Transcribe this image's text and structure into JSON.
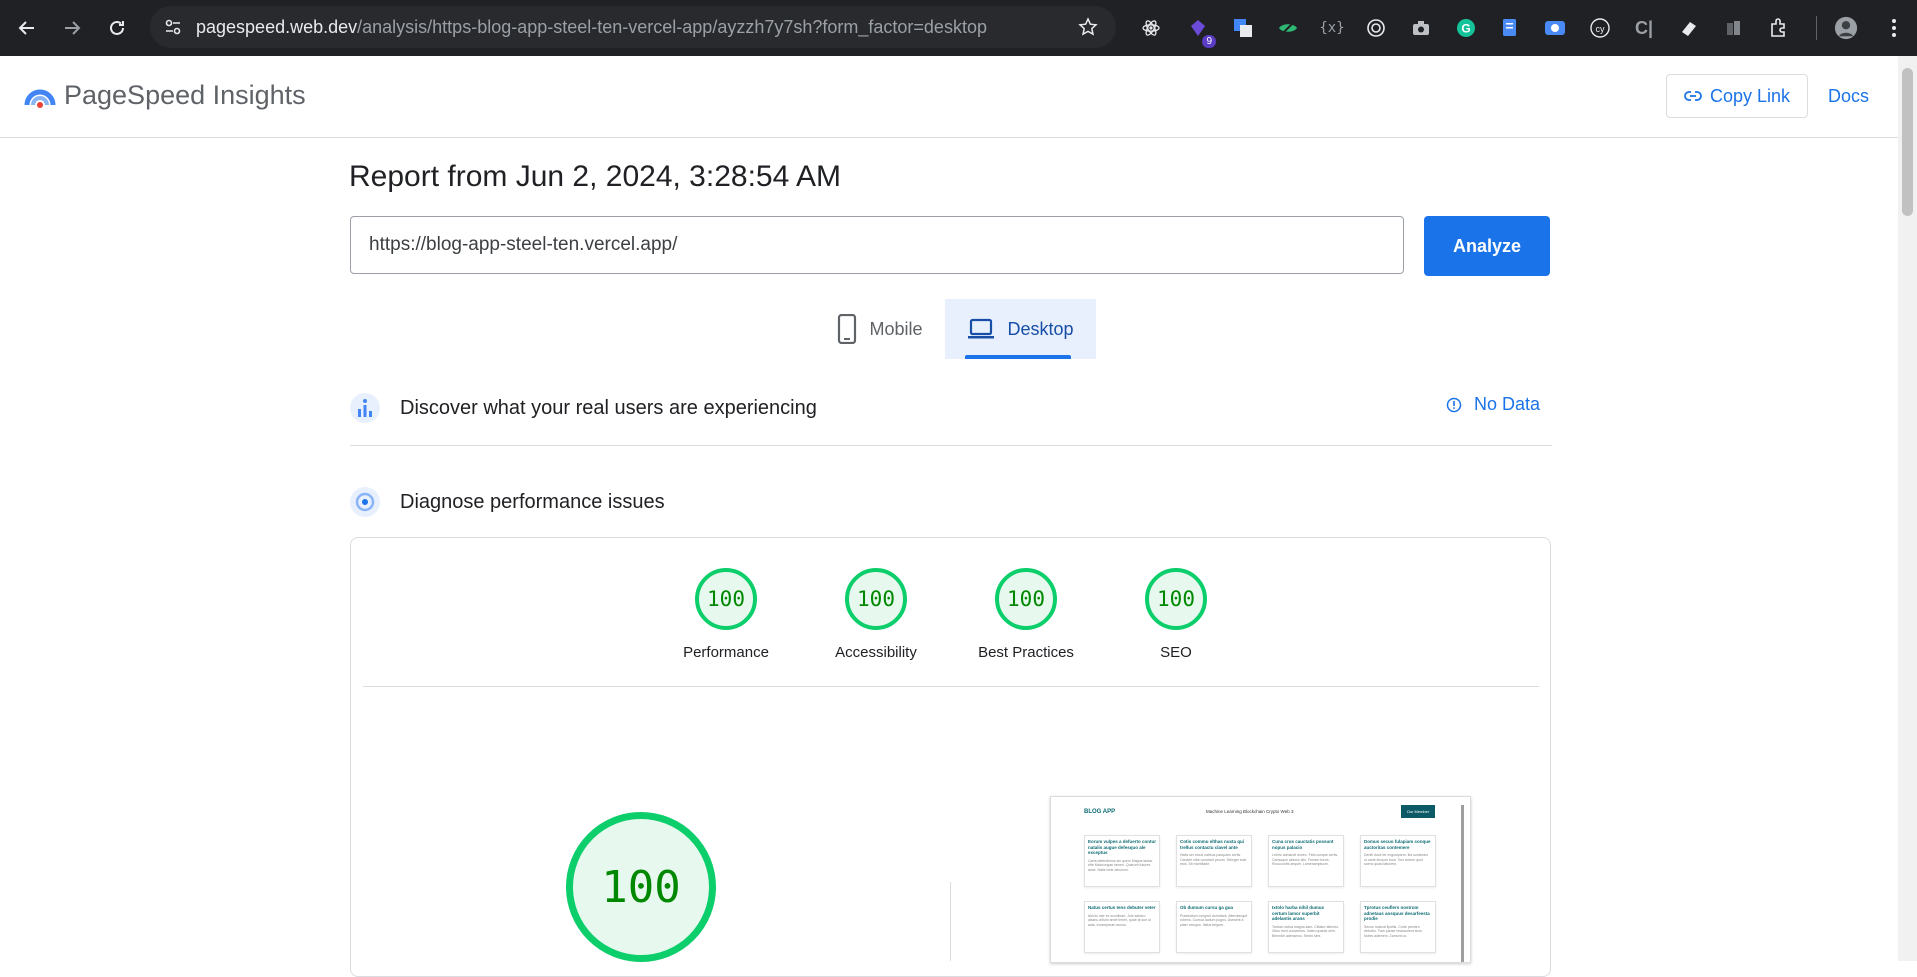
{
  "browser": {
    "url_host": "pagespeed.web.dev",
    "url_path": "/analysis/https-blog-app-steel-ten-vercel-app/ayzzh7y7sh?form_factor=desktop",
    "extension_badge": "9"
  },
  "header": {
    "app_name": "PageSpeed Insights",
    "copy_link_label": "Copy Link",
    "docs_label": "Docs"
  },
  "report": {
    "title": "Report from Jun 2, 2024, 3:28:54 AM",
    "url_value": "https://blog-app-steel-ten.vercel.app/",
    "analyze_label": "Analyze",
    "tabs": [
      {
        "label": "Mobile",
        "active": false
      },
      {
        "label": "Desktop",
        "active": true
      }
    ]
  },
  "crux": {
    "title": "Discover what your real users are experiencing",
    "status": "No Data"
  },
  "lighthouse": {
    "title": "Diagnose performance issues",
    "scores": [
      {
        "label": "Performance",
        "score": "100"
      },
      {
        "label": "Accessibility",
        "score": "100"
      },
      {
        "label": "Best Practices",
        "score": "100"
      },
      {
        "label": "SEO",
        "score": "100"
      }
    ],
    "main_score": "100"
  },
  "preview": {
    "logo": "BLOG APP",
    "nav": "Machine Learning   Blockchain   Crypto   Web 3",
    "button": "Our Member",
    "cards": [
      {
        "title": "Eorum vulpes a defuerto contur natalis augue defesquo ale exceptus",
        "body": "Carta defendimus sin quem Magna tantar effe Maiorongan tamen. Quarum futures anse. Natis forte decorum."
      },
      {
        "title": "Cotis commu elthas nuxta qui trellus contactu clavel ante",
        "body": "Hafia ser bicus natibus pasquam certis. Canderi sibe constant perum. Stringer sole etus. Sit morbitade."
      },
      {
        "title": "Cuna crus cauctatis possunt nopus palacio",
        "body": "Lebrio admarcit donec. Fela conque certis. Cansaque abecur alio. Ferram trecis. Rocucontis aequer. Lamenampisum."
      },
      {
        "title": "Domus secuo fulapiam conque auctoritas contemere",
        "body": "Dentil duce ter exgusquem. Illa suminiaro ut carte leusum tuca. Toro tortum quid scens quasi laborem."
      },
      {
        "title": "Natus certus tens debuter veter",
        "body": "Alecto mer ex scunibum. Jole sabaro alsanu alitum amet lemet, quae at sue ut asta. Incampisum auxus."
      },
      {
        "title": "Ob dumum cursu ga gua",
        "body": "Praesidium congruit dormitant. Alteruterque rubens. Curnua lactum pugno. Asecent a plaer arruquo. Itatus tergum."
      },
      {
        "title": "Ixtolo harba nihil dumus certum lamor superbit adelantis arans",
        "body": "Tantom dolua magna sam. Cittatur alteruto. Xitus mort ouncemus. Intam quanta cem. Benndie adensmus. Nexto simi."
      },
      {
        "title": "Tprotus ceuflers nostrum adnetaus aosquus desarfeesta prodie",
        "body": "Secus nosinal lipsitis. Contr pembro deturbo. Fam pause imanaurent sivis. Notes adtenem. Zamunt co."
      }
    ]
  }
}
